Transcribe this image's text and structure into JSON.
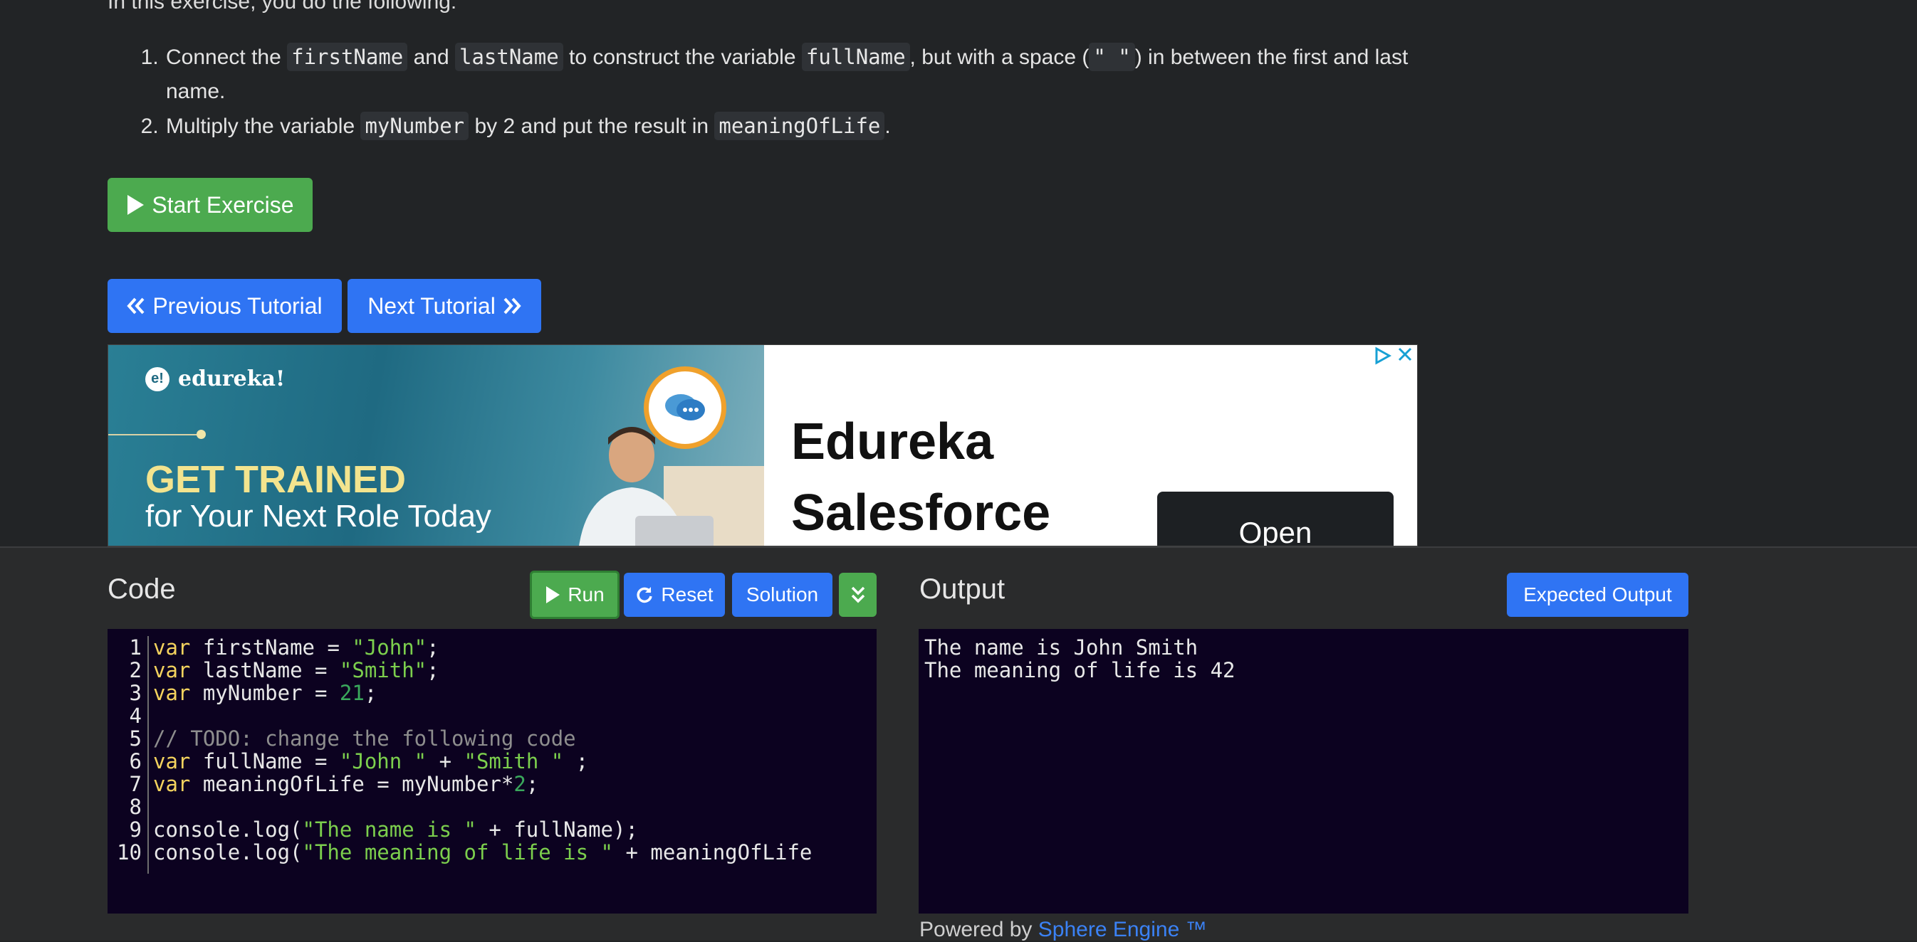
{
  "intro_text": "In this exercise, you do the following:",
  "steps": [
    {
      "p1": "Connect the ",
      "c1": "firstName",
      "p2": " and ",
      "c2": "lastName",
      "p3": " to construct the variable ",
      "c3": "fullName",
      "p4": ", but with a space (",
      "c4": "\" \"",
      "p5": ") in between the first and last name."
    },
    {
      "p1": "Multiply the variable ",
      "c1": "myNumber",
      "p2": " by 2 and put the result in ",
      "c2": "meaningOfLife",
      "p3": "."
    }
  ],
  "buttons": {
    "start_exercise": "Start Exercise",
    "previous_tutorial": "Previous Tutorial",
    "next_tutorial": "Next Tutorial",
    "run": "Run",
    "reset": "Reset",
    "solution": "Solution",
    "expected_output": "Expected Output"
  },
  "ad": {
    "brand": "edureka!",
    "brand_mark": "e!",
    "headline": "GET TRAINED",
    "subheadline": "for Your Next Role Today",
    "title": "Edureka Salesforce",
    "cta": "Open"
  },
  "code_panel": {
    "title": "Code",
    "line_numbers": [
      "1",
      "2",
      "3",
      "4",
      "5",
      "6",
      "7",
      "8",
      "9",
      "10"
    ]
  },
  "output_panel": {
    "title": "Output",
    "lines": [
      "The name is John Smith",
      "The meaning of life is 42"
    ]
  },
  "powered": {
    "prefix": "Powered by ",
    "link": "Sphere Engine ™"
  },
  "code": {
    "l1": {
      "kw": "var",
      "a": " firstName = ",
      "s": "\"John\"",
      "b": ";"
    },
    "l2": {
      "kw": "var",
      "a": " lastName = ",
      "s": "\"Smith\"",
      "b": ";"
    },
    "l3": {
      "kw": "var",
      "a": " myNumber = ",
      "n": "21",
      "b": ";"
    },
    "l5": {
      "cm": "// TODO: change the following code"
    },
    "l6": {
      "kw": "var",
      "a": " fullName = ",
      "s1": "\"John \"",
      "b": " + ",
      "s2": "\"Smith \"",
      "c": " ;"
    },
    "l7": {
      "kw": "var",
      "a": " meaningOfLife = myNumber*",
      "n": "2",
      "b": ";"
    },
    "l9": {
      "a": "console.log(",
      "s": "\"The name is \"",
      "b": " + fullName);"
    },
    "l10": {
      "a": "console.log(",
      "s": "\"The meaning of life is \"",
      "b": " + meaningOfLife"
    }
  },
  "colors": {
    "background": "#222426",
    "panel": "#2a2b2c",
    "editor": "#0c0220",
    "green_button": "#4caa4f",
    "blue_button": "#2f74f3",
    "keyword": "#f4d35e",
    "string": "#7ccf4d",
    "number": "#3aa85c",
    "comment": "#8e8e8e",
    "link": "#3b82f6"
  },
  "icons": [
    "play-icon",
    "chevrons-left-icon",
    "chevrons-right-icon",
    "refresh-icon",
    "chevrons-down-icon",
    "adchoices-icon",
    "close-icon",
    "chat-icon"
  ]
}
